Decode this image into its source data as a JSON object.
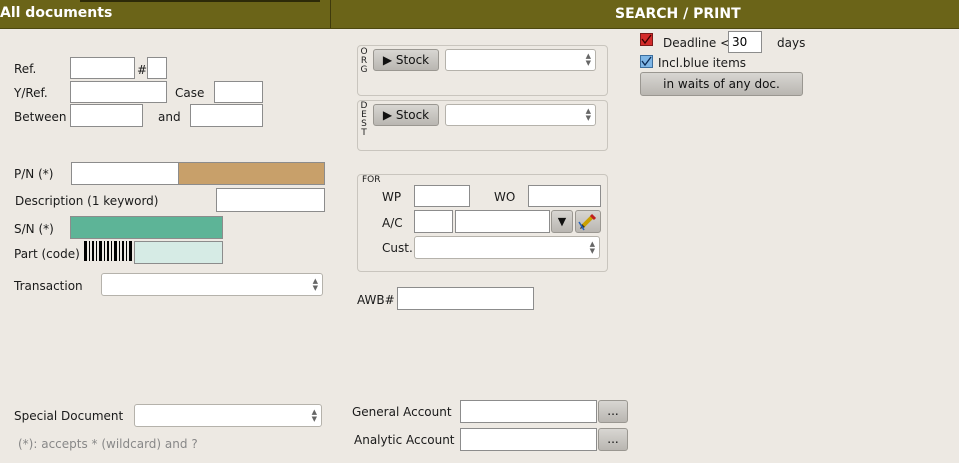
{
  "header": {
    "left_title": "All documents",
    "right_title": "SEARCH / PRINT"
  },
  "ref": {
    "label": "Ref.",
    "hash": "#",
    "value": "",
    "hash_value": ""
  },
  "yref": {
    "label": "Y/Ref.",
    "value": "",
    "case_label": "Case",
    "case_value": ""
  },
  "between": {
    "label": "Between",
    "from": "",
    "and_label": "and",
    "to": ""
  },
  "pn": {
    "label": "P/N (*)",
    "value": "",
    "color": "#c8a06a"
  },
  "description": {
    "label": "Description  (1 keyword)",
    "value": ""
  },
  "sn": {
    "label": "S/N (*)",
    "value": "",
    "color": "#5db497"
  },
  "part_code": {
    "label": "Part (code)",
    "value": "",
    "color": "#d6ebe5"
  },
  "transaction": {
    "label": "Transaction",
    "value": ""
  },
  "special_document": {
    "label": "Special Document",
    "value": ""
  },
  "wildcard_hint": "(*): accepts * (wildcard) and ?",
  "org": {
    "letters": [
      "O",
      "R",
      "G"
    ],
    "stock_button": "Stock",
    "value": ""
  },
  "dest": {
    "letters": [
      "D",
      "E",
      "S",
      "T"
    ],
    "stock_button": "Stock",
    "value": ""
  },
  "for": {
    "legend": "FOR",
    "wp_label": "WP",
    "wp_value": "",
    "wo_label": "WO",
    "wo_value": "",
    "ac_label": "A/C",
    "ac_value1": "",
    "ac_value2": "",
    "cust_label": "Cust.",
    "cust_value": ""
  },
  "awb": {
    "label": "AWB#",
    "value": ""
  },
  "general_account": {
    "label": "General Account",
    "value": "",
    "button": "..."
  },
  "analytic_account": {
    "label": "Analytic Account",
    "value": "",
    "button": "..."
  },
  "deadline": {
    "label": "Deadline <",
    "value": "30",
    "unit": "days",
    "checked": true
  },
  "incl_blue": {
    "label": "Incl.blue items",
    "checked": true
  },
  "waits_button": "in waits of any doc."
}
